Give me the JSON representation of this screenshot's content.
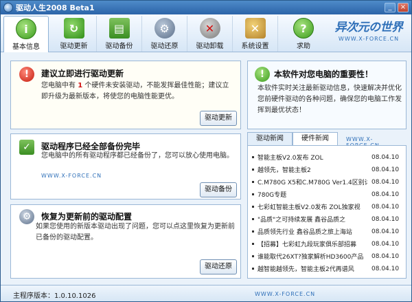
{
  "window": {
    "title": "驱动人生2008 Beta1"
  },
  "tabs": [
    {
      "label": "基本信息",
      "icon": "info-icon"
    },
    {
      "label": "驱动更新",
      "icon": "refresh-icon"
    },
    {
      "label": "驱动备份",
      "icon": "backup-icon"
    },
    {
      "label": "驱动还原",
      "icon": "restore-icon"
    },
    {
      "label": "驱动卸载",
      "icon": "uninstall-icon"
    },
    {
      "label": "系统设置",
      "icon": "settings-icon"
    },
    {
      "label": "求助",
      "icon": "help-icon"
    }
  ],
  "logo": {
    "big": "异次元の世界",
    "small": "WWW.X-FORCE.CN"
  },
  "update_card": {
    "title": "建议立即进行驱动更新",
    "text_pre": "您电脑中有",
    "count": "1",
    "text_post": "个硬件未安装驱动，不能发挥最佳性能；建议立即升级为最新版本，将使您的电脑性能更优。",
    "button": "驱动更新"
  },
  "backup_card": {
    "title": "驱动程序已经全部备份完毕",
    "text": "您电脑中的所有驱动程序都已经备份了，您可以放心使用电脑。",
    "watermark": "WWW.X-FORCE.CN",
    "button": "驱动备份"
  },
  "restore_card": {
    "title": "恢复为更新前的驱动配置",
    "text": "如果您使用的新版本驱动出现了问题，您可以点这里恢复为更新前已备份的驱动配置。",
    "button": "驱动还原"
  },
  "importance_card": {
    "title": "本软件对您电脑的重要性！",
    "text": "本软件实时关注最新驱动信息，快速解决并优化您前硬件驱动的各种问题，确保您的电脑工作发挥到最优状态！"
  },
  "news": {
    "tabs": [
      "驱动新闻",
      "硬件新闻"
    ],
    "watermark": "WWW.X-FORCE.CN",
    "items": [
      {
        "title": "智能主板V2.0发布 ZOL",
        "date": "08.04.10"
      },
      {
        "title": "越领先，智能主板2",
        "date": "08.04.10"
      },
      {
        "title": "C.M780G X5和C.M780G Ver1.4区别详",
        "date": "08.04.10"
      },
      {
        "title": "780G专题",
        "date": "08.04.10"
      },
      {
        "title": "七彩虹智能主板V2.0发布 ZOL独家视",
        "date": "08.04.10"
      },
      {
        "title": "\"品质\"之可持续发展 鑫谷品质之",
        "date": "08.04.10"
      },
      {
        "title": "品质领先行业 鑫谷品质之旅上海站",
        "date": "08.04.10"
      },
      {
        "title": "【招募】七彩虹九段玩家俱乐部招募",
        "date": "08.04.10"
      },
      {
        "title": "谁能取代26XT?独家解析HD3600产品",
        "date": "08.04.10"
      },
      {
        "title": "越智能越领先，智能主板2代再谱风",
        "date": "08.04.10"
      }
    ]
  },
  "status": {
    "version": "主程序版本：1.0.10.1026",
    "watermark": "WWW.X-FORCE.CN"
  }
}
